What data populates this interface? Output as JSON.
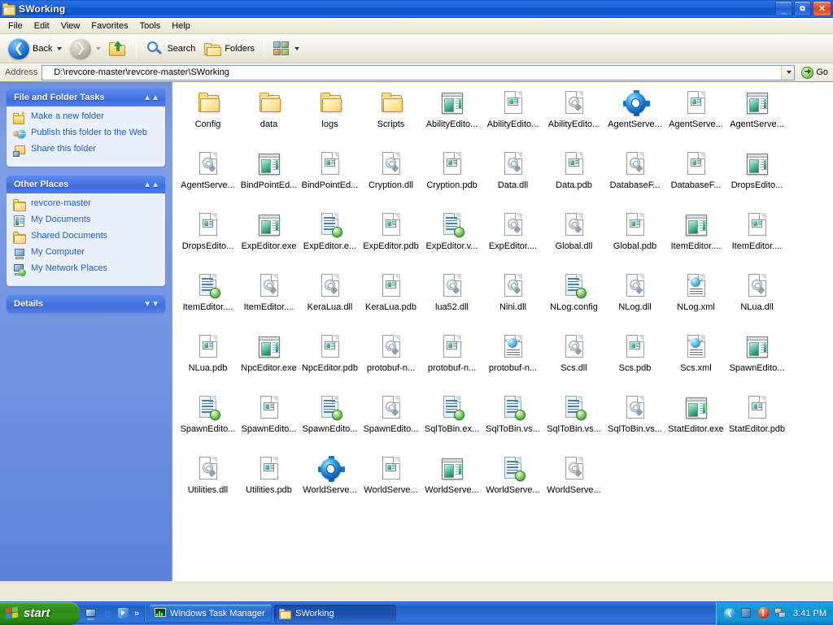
{
  "window": {
    "title": "SWorking",
    "title_icon": "folder-icon",
    "buttons": {
      "minimize": "_",
      "maximize": "❐",
      "close": "✕"
    }
  },
  "menu": {
    "items": [
      "File",
      "Edit",
      "View",
      "Favorites",
      "Tools",
      "Help"
    ]
  },
  "toolbar": {
    "back_label": "Back",
    "forward_label": "",
    "up_label": "",
    "search_label": "Search",
    "folders_label": "Folders",
    "views_label": "",
    "icons": [
      "back-arrow-icon",
      "forward-arrow-icon",
      "up-folder-icon",
      "search-magnifier-icon",
      "folders-icon",
      "views-icon"
    ]
  },
  "address": {
    "label": "Address",
    "path": "D:\\revcore-master\\revcore-master\\SWorking",
    "go_label": "Go",
    "dropdown_icon": "chevron-down-icon",
    "go_icon": "green-arrow-icon"
  },
  "task_pane": {
    "panels": [
      {
        "title": "File and Folder Tasks",
        "collapse_icon": "chevron-up-icon",
        "collapsed": false,
        "items": [
          {
            "label": "Make a new folder",
            "icon": "new-folder-icon"
          },
          {
            "label": "Publish this folder to the Web",
            "icon": "publish-web-icon"
          },
          {
            "label": "Share this folder",
            "icon": "share-folder-icon"
          }
        ]
      },
      {
        "title": "Other Places",
        "collapse_icon": "chevron-up-icon",
        "collapsed": false,
        "items": [
          {
            "label": "revcore-master",
            "icon": "folder-icon"
          },
          {
            "label": "My Documents",
            "icon": "my-documents-icon"
          },
          {
            "label": "Shared Documents",
            "icon": "shared-documents-icon"
          },
          {
            "label": "My Computer",
            "icon": "my-computer-icon"
          },
          {
            "label": "My Network Places",
            "icon": "my-network-places-icon"
          }
        ]
      },
      {
        "title": "Details",
        "collapse_icon": "chevron-down-icon",
        "collapsed": true,
        "items": []
      }
    ]
  },
  "files": [
    {
      "name": "Config",
      "icon": "folder"
    },
    {
      "name": "data",
      "icon": "folder"
    },
    {
      "name": "logs",
      "icon": "folder"
    },
    {
      "name": "Scripts",
      "icon": "folder"
    },
    {
      "name": "AbilityEdito...",
      "icon": "app"
    },
    {
      "name": "AbilityEdito...",
      "icon": "mod"
    },
    {
      "name": "AbilityEdito...",
      "icon": "dll"
    },
    {
      "name": "AgentServe...",
      "icon": "gear"
    },
    {
      "name": "AgentServe...",
      "icon": "mod"
    },
    {
      "name": "AgentServe...",
      "icon": "app"
    },
    {
      "name": "AgentServe...",
      "icon": "dll"
    },
    {
      "name": "BindPointEd...",
      "icon": "app"
    },
    {
      "name": "BindPointEd...",
      "icon": "mod"
    },
    {
      "name": "Cryption.dll",
      "icon": "dll"
    },
    {
      "name": "Cryption.pdb",
      "icon": "mod"
    },
    {
      "name": "Data.dll",
      "icon": "dll"
    },
    {
      "name": "Data.pdb",
      "icon": "mod"
    },
    {
      "name": "DatabaseF...",
      "icon": "dll"
    },
    {
      "name": "DatabaseF...",
      "icon": "mod"
    },
    {
      "name": "DropsEdito...",
      "icon": "app"
    },
    {
      "name": "DropsEdito...",
      "icon": "mod"
    },
    {
      "name": "ExpEditor.exe",
      "icon": "app"
    },
    {
      "name": "ExpEditor.e...",
      "icon": "cfg"
    },
    {
      "name": "ExpEditor.pdb",
      "icon": "mod"
    },
    {
      "name": "ExpEditor.v...",
      "icon": "cfg"
    },
    {
      "name": "ExpEditor....",
      "icon": "dll"
    },
    {
      "name": "Global.dll",
      "icon": "dll"
    },
    {
      "name": "Global.pdb",
      "icon": "mod"
    },
    {
      "name": "ItemEditor....",
      "icon": "app"
    },
    {
      "name": "ItemEditor....",
      "icon": "mod"
    },
    {
      "name": "ItemEditor....",
      "icon": "cfg"
    },
    {
      "name": "ItemEditor....",
      "icon": "dll"
    },
    {
      "name": "KeraLua.dll",
      "icon": "dll"
    },
    {
      "name": "KeraLua.pdb",
      "icon": "mod"
    },
    {
      "name": "lua52.dll",
      "icon": "dll"
    },
    {
      "name": "Nini.dll",
      "icon": "dll"
    },
    {
      "name": "NLog.config",
      "icon": "cfg"
    },
    {
      "name": "NLog.dll",
      "icon": "dll"
    },
    {
      "name": "NLog.xml",
      "icon": "xml"
    },
    {
      "name": "NLua.dll",
      "icon": "dll"
    },
    {
      "name": "NLua.pdb",
      "icon": "mod"
    },
    {
      "name": "NpcEditor.exe",
      "icon": "app"
    },
    {
      "name": "NpcEditor.pdb",
      "icon": "mod"
    },
    {
      "name": "protobuf-n...",
      "icon": "dll"
    },
    {
      "name": "protobuf-n...",
      "icon": "mod"
    },
    {
      "name": "protobuf-n...",
      "icon": "xml"
    },
    {
      "name": "Scs.dll",
      "icon": "dll"
    },
    {
      "name": "Scs.pdb",
      "icon": "mod"
    },
    {
      "name": "Scs.xml",
      "icon": "xml"
    },
    {
      "name": "SpawnEdito...",
      "icon": "app"
    },
    {
      "name": "SpawnEdito...",
      "icon": "cfg"
    },
    {
      "name": "SpawnEdito...",
      "icon": "mod"
    },
    {
      "name": "SpawnEdito...",
      "icon": "cfg"
    },
    {
      "name": "SpawnEdito...",
      "icon": "dll"
    },
    {
      "name": "SqlToBin.ex...",
      "icon": "cfg"
    },
    {
      "name": "SqlToBin.vs...",
      "icon": "cfg"
    },
    {
      "name": "SqlToBin.vs...",
      "icon": "cfg"
    },
    {
      "name": "SqlToBin.vs...",
      "icon": "dll"
    },
    {
      "name": "StatEditor.exe",
      "icon": "app"
    },
    {
      "name": "StatEditor.pdb",
      "icon": "mod"
    },
    {
      "name": "Utilities.dll",
      "icon": "dll"
    },
    {
      "name": "Utilities.pdb",
      "icon": "mod"
    },
    {
      "name": "WorldServe...",
      "icon": "gear"
    },
    {
      "name": "WorldServe...",
      "icon": "mod"
    },
    {
      "name": "WorldServe...",
      "icon": "app"
    },
    {
      "name": "WorldServe...",
      "icon": "cfg"
    },
    {
      "name": "WorldServe...",
      "icon": "dll"
    }
  ],
  "taskbar": {
    "start_label": "start",
    "start_icon": "windows-flag-icon",
    "quick_launch": [
      {
        "icon": "show-desktop-icon"
      },
      {
        "icon": "internet-explorer-icon"
      },
      {
        "icon": "windows-media-player-icon"
      }
    ],
    "quick_launch_overflow": "»",
    "tasks": [
      {
        "label": "Windows Task Manager",
        "icon": "task-manager-icon",
        "active": false
      },
      {
        "label": "SWorking",
        "icon": "folder-icon",
        "active": true
      }
    ],
    "tray": {
      "expand_icon": "chevron-left-icon",
      "icons": [
        "blue-square-icon",
        "security-alert-icon",
        "network-icon"
      ],
      "clock": "3:41 PM"
    }
  },
  "colors": {
    "title_blue": "#1059ce",
    "taskbar_blue": "#225fc6",
    "start_green": "#2e8a18",
    "pane_blue": "#6f92e1",
    "link_blue": "#215dc6",
    "close_red": "#d9431d"
  }
}
